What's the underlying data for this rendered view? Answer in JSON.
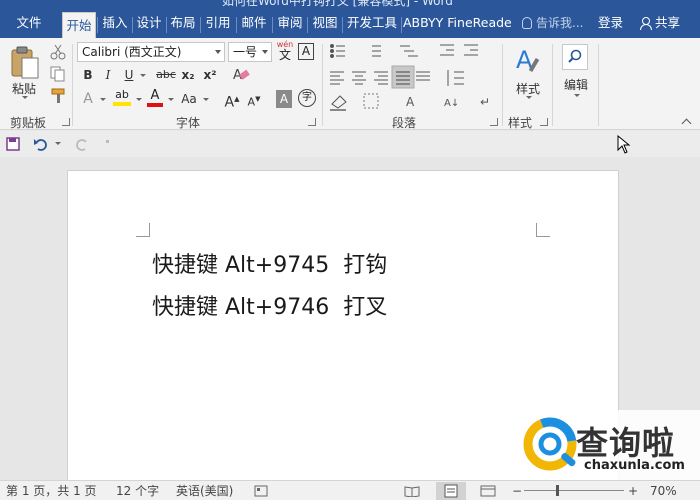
{
  "window": {
    "title": "如何在Word中打钩打叉 [兼容模式] - Word"
  },
  "tabs": [
    {
      "label": "文件"
    },
    {
      "label": "开始"
    },
    {
      "label": "插入"
    },
    {
      "label": "设计"
    },
    {
      "label": "布局"
    },
    {
      "label": "引用"
    },
    {
      "label": "邮件"
    },
    {
      "label": "审阅"
    },
    {
      "label": "视图"
    },
    {
      "label": "开发工具"
    },
    {
      "label": "ABBYY FineReade"
    }
  ],
  "tell_me": "告诉我...",
  "login": "登录",
  "share": "共享",
  "clipboard": {
    "paste": "粘贴",
    "group": "剪贴板"
  },
  "font": {
    "name": "Calibri (西文正文)",
    "size": "一号",
    "wen": "wén",
    "wen_char": "文",
    "group": "字体",
    "bold": "B",
    "italic": "I",
    "underline": "U",
    "strike": "abc",
    "sub": "x₂",
    "sup": "x²",
    "grow": "A",
    "shrink": "A",
    "case": "Aa",
    "effects": "A",
    "highlight": "ab",
    "color": "A",
    "shade": "A",
    "enclose": "字"
  },
  "paragraph": {
    "group": "段落"
  },
  "styles": {
    "label": "样式",
    "group": "样式"
  },
  "editing": {
    "label": "编辑"
  },
  "document": {
    "lines": [
      "快捷键 Alt+9745  打钩",
      "快捷键 Alt+9746  打叉"
    ]
  },
  "statusbar": {
    "page": "第 1 页，共 1 页",
    "words": "12 个字",
    "lang": "英语(美国)",
    "zoom": "70%"
  },
  "watermark": {
    "name": "查询啦",
    "url": "chaxunla.com"
  },
  "colors": {
    "ribbon_blue": "#2b579a",
    "accent_yellow": "#f2b705",
    "accent_blue": "#1d8fe0"
  }
}
